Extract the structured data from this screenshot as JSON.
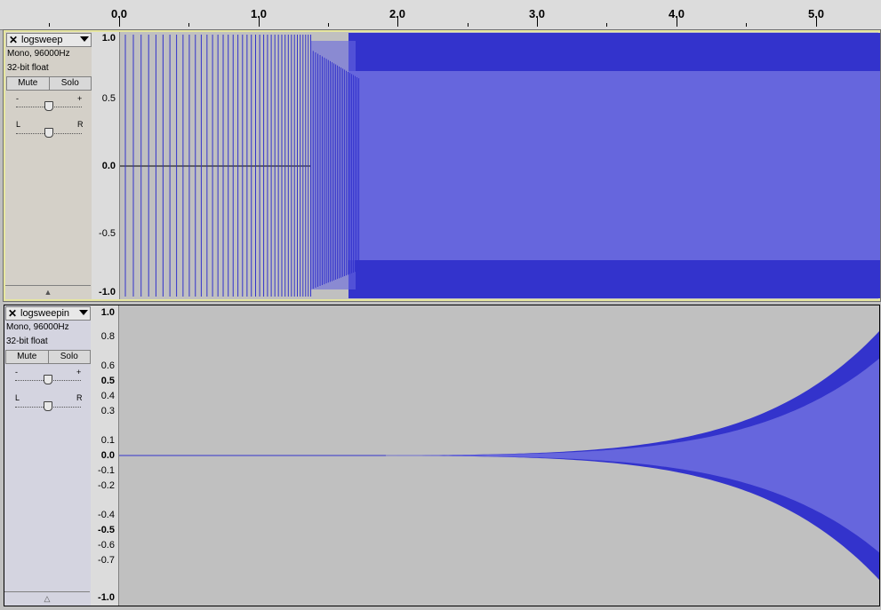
{
  "ruler": {
    "labels": [
      "0.0",
      "1.0",
      "2.0",
      "3.0",
      "4.0",
      "5.0"
    ]
  },
  "tracks": [
    {
      "name": "logsweep",
      "format": "Mono, 96000Hz",
      "bitdepth": "32-bit float",
      "mute_label": "Mute",
      "solo_label": "Solo",
      "gain_minus": "-",
      "gain_plus": "+",
      "pan_left": "L",
      "pan_right": "R",
      "scale": [
        "1.0",
        "0.5",
        "0.0",
        "-0.5",
        "-1.0"
      ]
    },
    {
      "name": "logsweepin",
      "format": "Mono, 96000Hz",
      "bitdepth": "32-bit float",
      "mute_label": "Mute",
      "solo_label": "Solo",
      "gain_minus": "-",
      "gain_plus": "+",
      "pan_left": "L",
      "pan_right": "R",
      "scale": [
        "1.0",
        "0.8",
        "0.6",
        "0.5",
        "0.4",
        "0.3",
        "0.1",
        "0.0",
        "-0.1",
        "-0.2",
        "-0.4",
        "-0.5",
        "-0.6",
        "-0.7",
        "-1.0"
      ]
    }
  ],
  "colors": {
    "wave_dark": "#3333cc",
    "wave_light": "#6666dd",
    "track_bg": "#c0c0c0"
  }
}
